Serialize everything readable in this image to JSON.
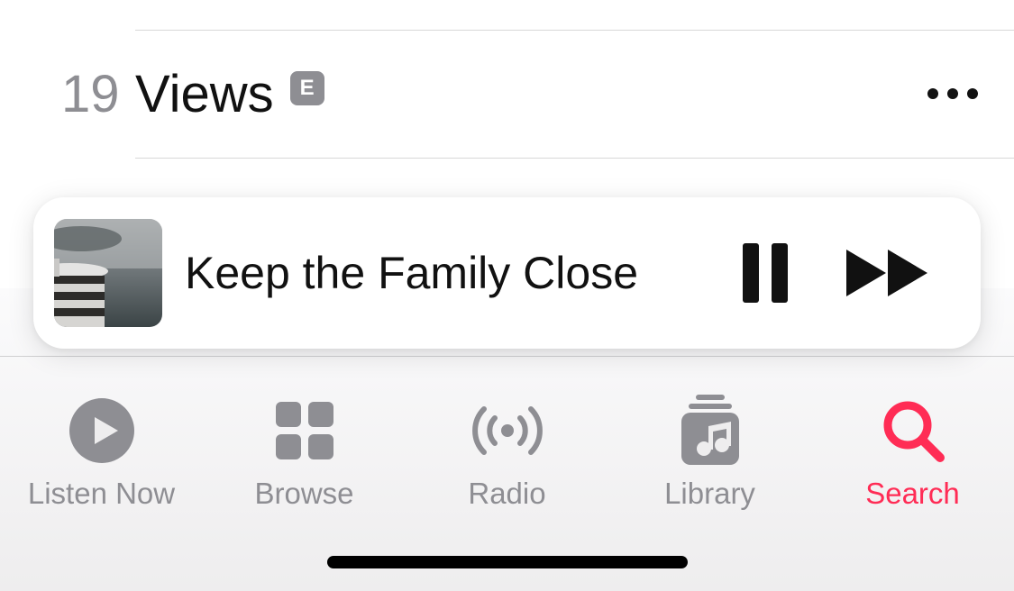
{
  "track": {
    "number": "19",
    "title": "Views",
    "explicit_label": "E"
  },
  "now_playing": {
    "title": "Keep the Family Close"
  },
  "tabs": {
    "listen_now": "Listen Now",
    "browse": "Browse",
    "radio": "Radio",
    "library": "Library",
    "search": "Search"
  },
  "colors": {
    "inactive": "#8e8e93",
    "active": "#ff2c55"
  },
  "active_tab": "search"
}
